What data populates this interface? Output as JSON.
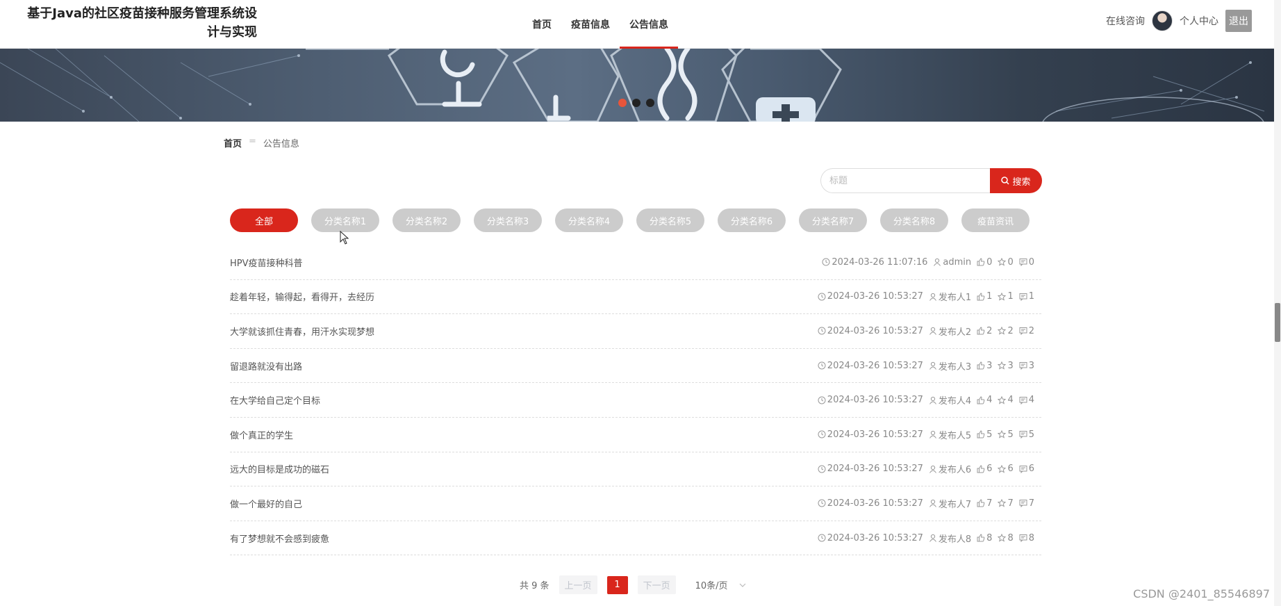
{
  "header": {
    "title": "基于Java的社区疫苗接种服务管理系统设计与实现",
    "nav": [
      {
        "label": "首页"
      },
      {
        "label": "疫苗信息"
      },
      {
        "label": "公告信息"
      }
    ],
    "online_consult": "在线咨询",
    "personal_center": "个人中心",
    "logout": "退出"
  },
  "banner": {
    "slides": 3,
    "active_slide": 1
  },
  "breadcrumb": {
    "home": "首页",
    "separator": "=",
    "current": "公告信息"
  },
  "search": {
    "placeholder": "标题",
    "button_label": "搜索"
  },
  "categories": [
    {
      "label": "全部",
      "active": true
    },
    {
      "label": "分类名称1"
    },
    {
      "label": "分类名称2"
    },
    {
      "label": "分类名称3"
    },
    {
      "label": "分类名称4"
    },
    {
      "label": "分类名称5"
    },
    {
      "label": "分类名称6"
    },
    {
      "label": "分类名称7"
    },
    {
      "label": "分类名称8"
    },
    {
      "label": "疫苗资讯"
    }
  ],
  "notices": [
    {
      "title": "HPV疫苗接种科普",
      "time": "2024-03-26 11:07:16",
      "author": "admin",
      "likes": "0",
      "favorites": "0",
      "comments": "0"
    },
    {
      "title": "趁着年轻，输得起，看得开，去经历",
      "time": "2024-03-26 10:53:27",
      "author": "发布人1",
      "likes": "1",
      "favorites": "1",
      "comments": "1"
    },
    {
      "title": "大学就该抓住青春，用汗水实现梦想",
      "time": "2024-03-26 10:53:27",
      "author": "发布人2",
      "likes": "2",
      "favorites": "2",
      "comments": "2"
    },
    {
      "title": "留退路就没有出路",
      "time": "2024-03-26 10:53:27",
      "author": "发布人3",
      "likes": "3",
      "favorites": "3",
      "comments": "3"
    },
    {
      "title": "在大学给自己定个目标",
      "time": "2024-03-26 10:53:27",
      "author": "发布人4",
      "likes": "4",
      "favorites": "4",
      "comments": "4"
    },
    {
      "title": "做个真正的学生",
      "time": "2024-03-26 10:53:27",
      "author": "发布人5",
      "likes": "5",
      "favorites": "5",
      "comments": "5"
    },
    {
      "title": "远大的目标是成功的磁石",
      "time": "2024-03-26 10:53:27",
      "author": "发布人6",
      "likes": "6",
      "favorites": "6",
      "comments": "6"
    },
    {
      "title": "做一个最好的自己",
      "time": "2024-03-26 10:53:27",
      "author": "发布人7",
      "likes": "7",
      "favorites": "7",
      "comments": "7"
    },
    {
      "title": "有了梦想就不会感到疲惫",
      "time": "2024-03-26 10:53:27",
      "author": "发布人8",
      "likes": "8",
      "favorites": "8",
      "comments": "8"
    }
  ],
  "pagination": {
    "total": "共 9 条",
    "prev": "上一页",
    "current_page": "1",
    "next": "下一页",
    "page_size": "10条/页"
  },
  "watermark": "CSDN @2401_85546897",
  "colors": {
    "accent": "#d9261c",
    "pill_inactive": "#cccccc",
    "logout_bg": "#999999"
  }
}
